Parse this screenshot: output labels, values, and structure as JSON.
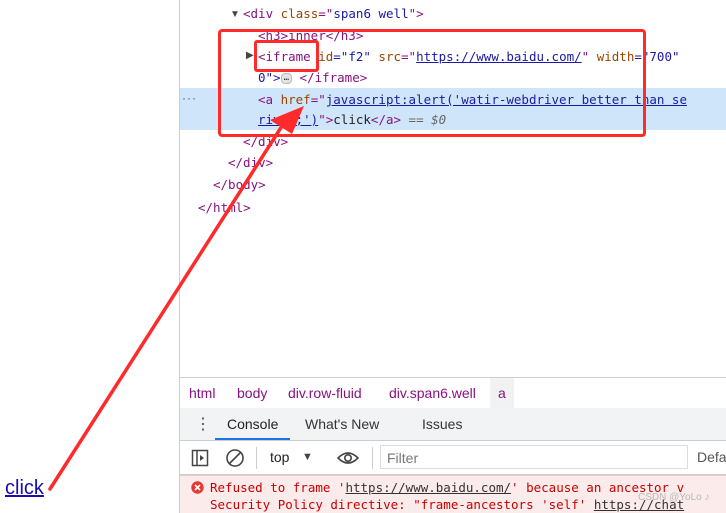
{
  "page": {
    "link_text": "click"
  },
  "elements": {
    "l1": {
      "open": "<div ",
      "attr": "class",
      "eq": "=\"",
      "val": "span6 well",
      "close": "\">"
    },
    "l2": {
      "text": "<h3>inner</h3>"
    },
    "l3": {
      "open": "<iframe",
      "attr1": " id",
      "val1": "=\"f2\"",
      "attr2": " src",
      "eq2": "=\"",
      "url": "https://www.baidu.com/",
      "q2": "\"",
      "attr3": " width",
      "val3": "=\"700\""
    },
    "l4": {
      "pre": "0\">",
      "ellipsis": "…",
      "close": "</iframe>"
    },
    "l5": {
      "open": "<a ",
      "attr": "href",
      "eq": "=\"",
      "js": "javascript:alert('watir-webdriver better than se"
    },
    "l6": {
      "js2": "river;')",
      "q": "\"",
      "tag": ">",
      "text": "click",
      "close": "</a>",
      "eq0": " == $0"
    },
    "l7": "</div>",
    "l8": "</div>",
    "l9": "</body>",
    "l10": "</html>",
    "selected_dots": "···"
  },
  "breadcrumbs": [
    "html",
    "body",
    "div.row-fluid",
    "div.span6.well",
    "a"
  ],
  "tabs": {
    "console": "Console",
    "whats_new": "What's New",
    "issues": "Issues"
  },
  "toolbar": {
    "context": "top",
    "filter_placeholder": "Filter",
    "levels": "Defa"
  },
  "error": {
    "line1_pre": "Refused to frame '",
    "line1_url": "https://www.baidu.com/",
    "line1_post": "' because an ancestor v",
    "line2_pre": "Security Policy directive: \"frame-ancestors 'self' ",
    "line2_url": "https://chat"
  },
  "watermark": "CSDN @YoLo ♪",
  "colors": {
    "annotation": "#ff2a2a",
    "selection": "#cfe5fa",
    "tag": "#881280",
    "attribute": "#994500",
    "value": "#1a1aa6"
  }
}
